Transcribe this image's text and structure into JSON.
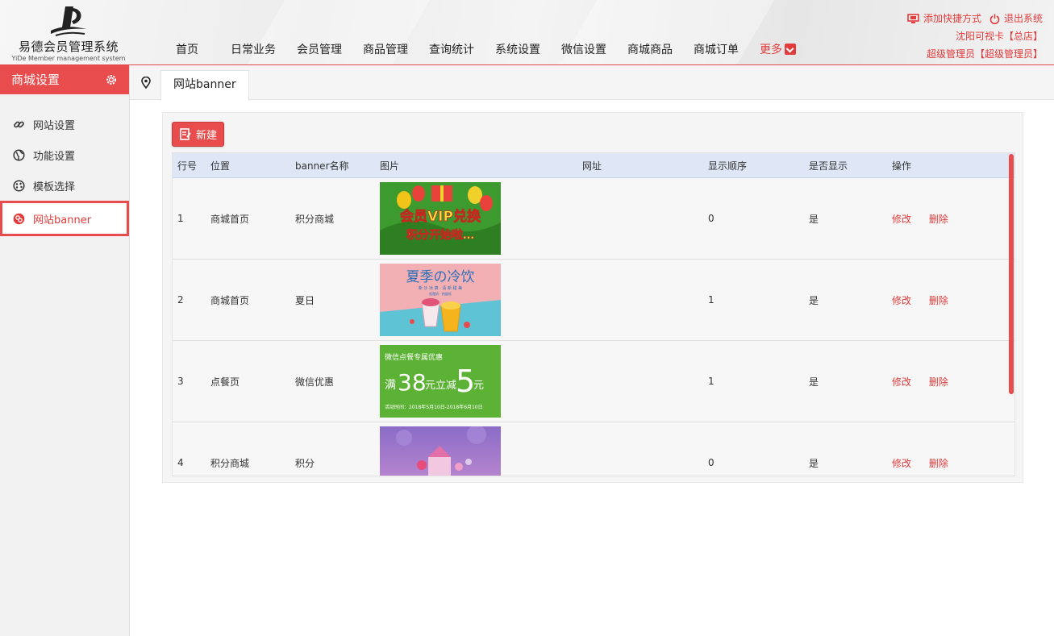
{
  "logo": {
    "name_cn": "易德会员管理系统",
    "name_en": "YiDe Member management system"
  },
  "nav": {
    "items": [
      "首页",
      "日常业务",
      "会员管理",
      "商品管理",
      "查询统计",
      "系统设置",
      "微信设置",
      "商城商品",
      "商城订单"
    ],
    "more": "更多"
  },
  "top_right": {
    "shortcut": "添加快捷方式",
    "logout": "退出系统",
    "store": "沈阳可视卡【总店】",
    "user": "超级管理员【超级管理员】"
  },
  "sidebar": {
    "title": "商城设置",
    "items": [
      {
        "label": "网站设置",
        "icon": "link-icon"
      },
      {
        "label": "功能设置",
        "icon": "globe-icon"
      },
      {
        "label": "模板选择",
        "icon": "palette-icon"
      },
      {
        "label": "网站banner",
        "icon": "banner-icon",
        "active": true
      }
    ]
  },
  "tab": {
    "label": "网站banner"
  },
  "toolbar": {
    "new_label": "新建"
  },
  "table": {
    "columns": [
      "行号",
      "位置",
      "banner名称",
      "图片",
      "网址",
      "显示顺序",
      "是否显示",
      "操作"
    ],
    "rows": [
      {
        "no": "1",
        "position": "商城首页",
        "name": "积分商城",
        "url": "",
        "order": "0",
        "visible": "是"
      },
      {
        "no": "2",
        "position": "商城首页",
        "name": "夏日",
        "url": "",
        "order": "1",
        "visible": "是"
      },
      {
        "no": "3",
        "position": "点餐页",
        "name": "微信优惠",
        "url": "",
        "order": "1",
        "visible": "是"
      },
      {
        "no": "4",
        "position": "积分商城",
        "name": "积分",
        "url": "",
        "order": "0",
        "visible": "是"
      }
    ],
    "edit_label": "修改",
    "delete_label": "删除"
  },
  "banners": {
    "b1": {
      "line1": "会员VIP兑换",
      "line2": "积分开始啦…"
    },
    "b2": {
      "title": "夏季の冷饮",
      "sub1": "新 沙 冰 爽 · 清 新 甜 美",
      "sub2": "低脂奶 · 热量低"
    },
    "b3": {
      "head": "微信点餐专属优惠",
      "man": "满",
      "n1": "38",
      "mid": "元立减",
      "n2": "5",
      "yuan": "元",
      "date": "活动时间：2018年5月10日-2018年6月10日"
    }
  },
  "colors": {
    "accent": "#e84c4c",
    "table_header": "#dfe7f7"
  }
}
